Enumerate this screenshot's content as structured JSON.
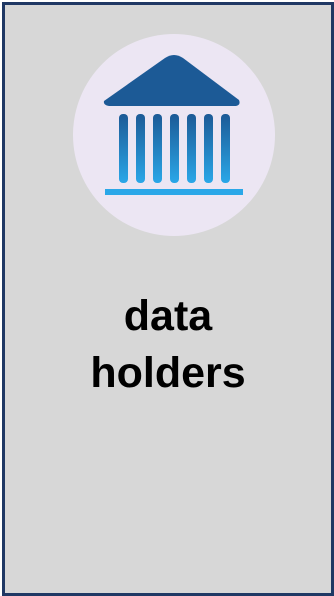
{
  "card": {
    "label_line1": "data",
    "label_line2": "holders",
    "icon": "bank-building-icon",
    "colors": {
      "border": "#1f3864",
      "background": "#d7d7d7",
      "icon_circle": "#ece6f3",
      "icon_roof": "#1c5a96",
      "icon_columns_top": "#1c5a96",
      "icon_columns_bottom": "#2aa7e8",
      "icon_base": "#2aa7e8",
      "text": "#000000"
    }
  }
}
